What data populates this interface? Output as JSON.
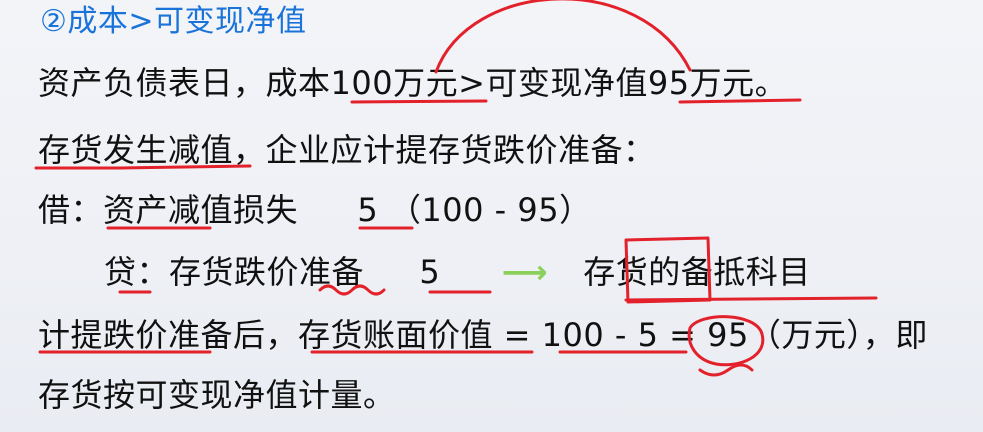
{
  "title": "②成本>可变现净值",
  "line1": "资产负债表日，成本100万元>可变现净值95万元。",
  "line2": "存货发生减值，企业应计提存货跌价准备：",
  "line3": {
    "debit_label": "借：",
    "account": "资产减值损失",
    "amount": "5",
    "calc": "（100 - 95）"
  },
  "line4": {
    "credit_label": "贷：",
    "account": "存货跌价准备",
    "amount": "5",
    "arrow": "⟶",
    "note": "存货的备抵科目"
  },
  "line5": "计提跌价准备后，存货账面价值 = 100 - 5 = 95（万元），即",
  "line6": "存货按可变现净值计量。",
  "colors": {
    "title": "#1a73d9",
    "text": "#111111",
    "annotation": "#e3212b",
    "arrow": "#8bd05a"
  }
}
